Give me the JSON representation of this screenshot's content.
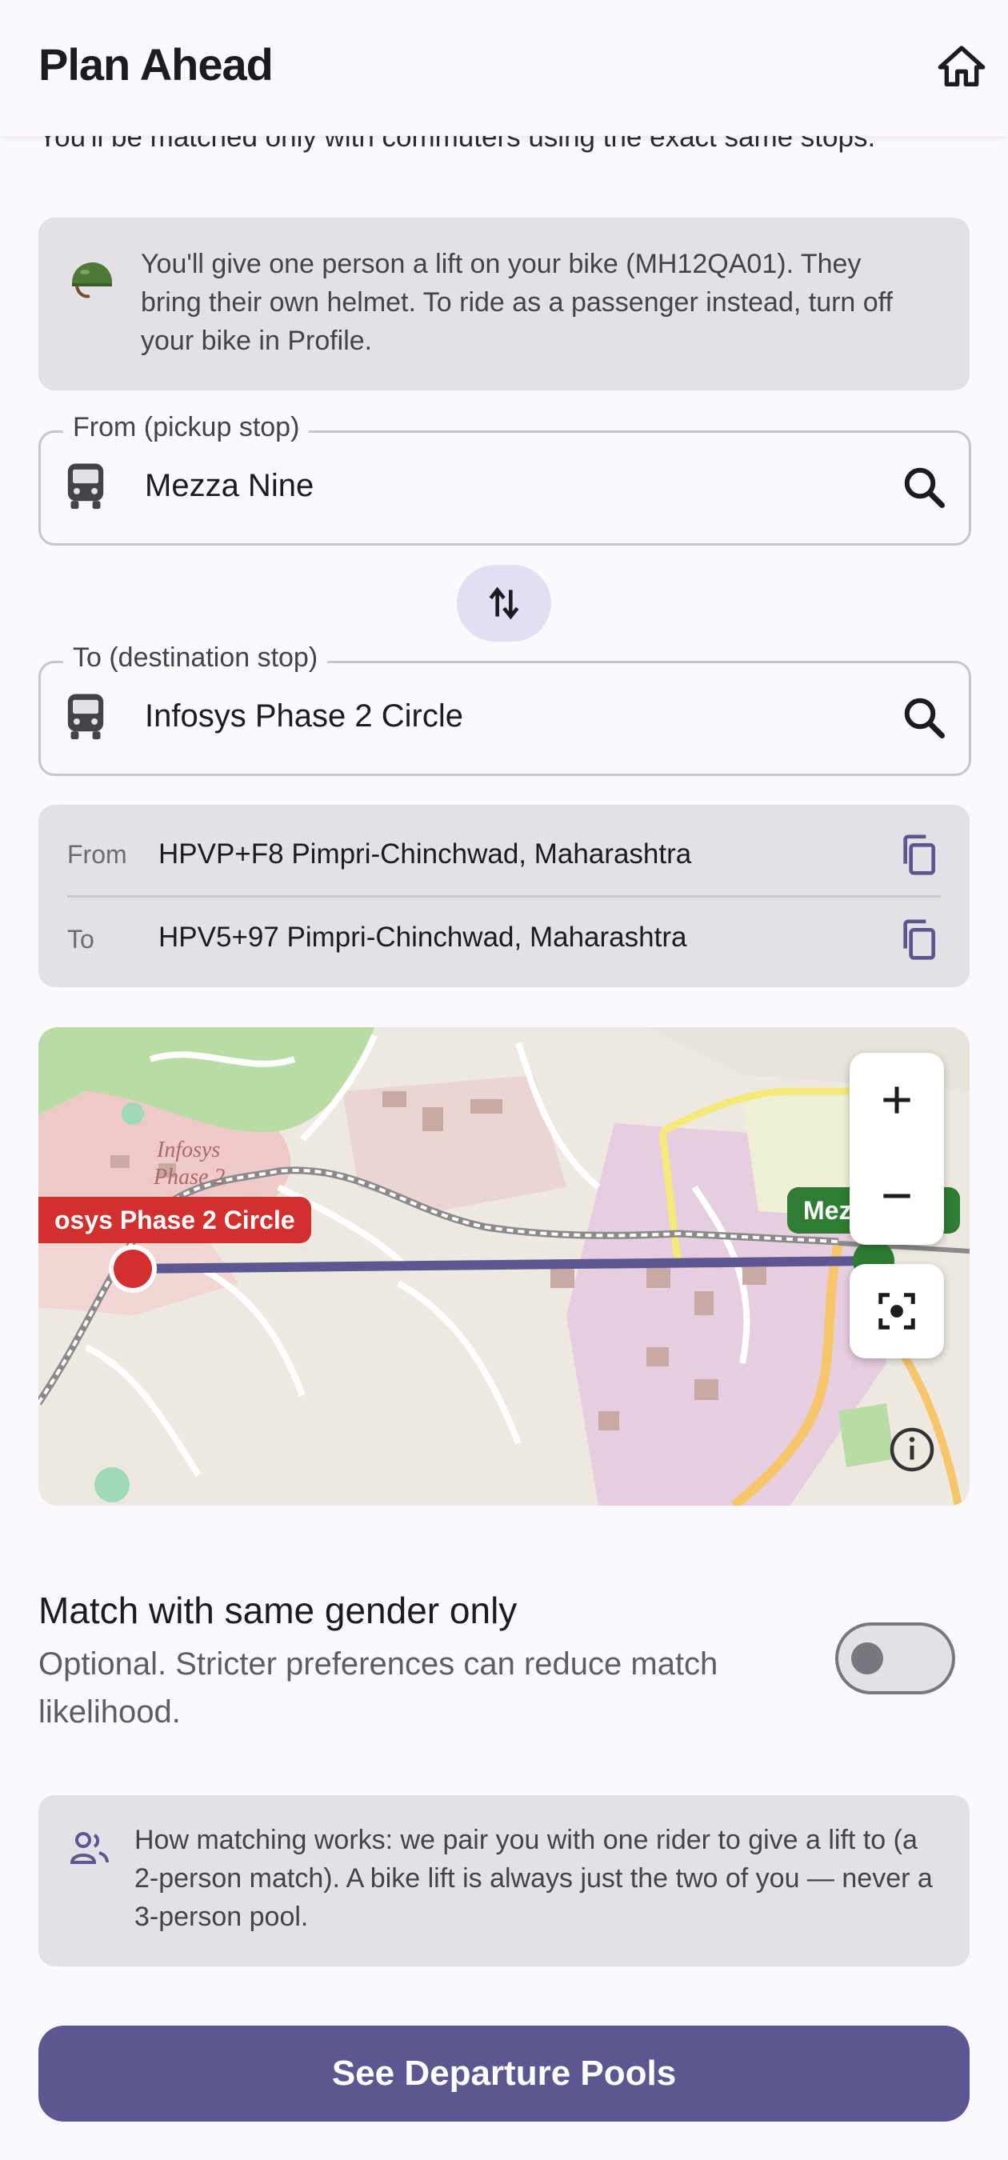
{
  "appbar": {
    "title": "Plan Ahead",
    "home_icon": "home-icon"
  },
  "intro_text": "You'll be matched only with commuters using the exact same stops.",
  "bike_notice": {
    "icon": "helmet-icon",
    "text": "You'll give one person a lift on your bike (MH12QA01). They bring their own helmet. To ride as a passenger instead, turn off your bike in Profile."
  },
  "from_field": {
    "label": "From (pickup stop)",
    "value": "Mezza Nine",
    "icon": "bus-icon",
    "action_icon": "search-icon"
  },
  "swap": {
    "icon": "swap-vertical-icon"
  },
  "to_field": {
    "label": "To (destination stop)",
    "value": "Infosys Phase 2 Circle",
    "icon": "bus-icon",
    "action_icon": "search-icon"
  },
  "addresses": {
    "from_key": "From",
    "from_value": "HPVP+F8 Pimpri-Chinchwad, Maharashtra",
    "to_key": "To",
    "to_value": "HPV5+97 Pimpri-Chinchwad, Maharashtra",
    "copy_icon": "copy-icon"
  },
  "map": {
    "destination_label": "osys Phase 2 Circle",
    "origin_label": "Mez",
    "area_label_1": "Infosys",
    "area_label_2": "Phase 2",
    "zoom_in_icon": "plus-icon",
    "zoom_out_icon": "minus-icon",
    "fit_icon": "center-focus-icon",
    "info_icon": "info-icon",
    "colors": {
      "route": "#5C5791",
      "destination": "#D32F2F",
      "origin": "#2E7D32"
    }
  },
  "gender": {
    "title": "Match with same gender only",
    "subtitle": "Optional. Stricter preferences can reduce match likelihood.",
    "enabled": false
  },
  "how_matching": {
    "icon": "people-icon",
    "text": "How matching works: we pair you with one rider to give a lift to (a 2-person match). A bike lift is always just the two of you — never a 3-person pool."
  },
  "cta": {
    "label": "See Departure Pools"
  }
}
